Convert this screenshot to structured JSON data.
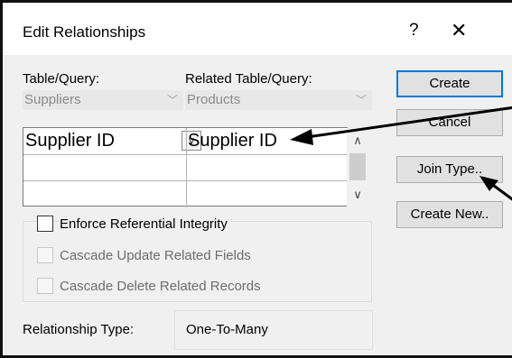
{
  "window": {
    "title": "Edit Relationships",
    "help_glyph": "?",
    "close_glyph": "✕"
  },
  "table_query": {
    "label": "Table/Query:",
    "value": "Suppliers"
  },
  "related_table_query": {
    "label": "Related Table/Query:",
    "value": "Products"
  },
  "field_grid": {
    "rows": [
      {
        "left": "Supplier ID",
        "right": "Supplier ID"
      },
      {
        "left": "",
        "right": ""
      },
      {
        "left": "",
        "right": ""
      }
    ]
  },
  "options": {
    "enforce_referential_integrity": {
      "label": "Enforce Referential Integrity",
      "checked": false,
      "enabled": true
    },
    "cascade_update": {
      "label": "Cascade Update Related Fields",
      "checked": false,
      "enabled": false
    },
    "cascade_delete": {
      "label": "Cascade Delete Related Records",
      "checked": false,
      "enabled": false
    }
  },
  "relationship_type": {
    "label": "Relationship Type:",
    "value": "One-To-Many"
  },
  "buttons": {
    "create": "Create",
    "cancel": "Cancel",
    "join_type": "Join Type..",
    "create_new": "Create New.."
  },
  "colors": {
    "accent": "#0078d7",
    "dialog_bg": "#f0f0f0",
    "annotation_arrow": "#000000"
  }
}
